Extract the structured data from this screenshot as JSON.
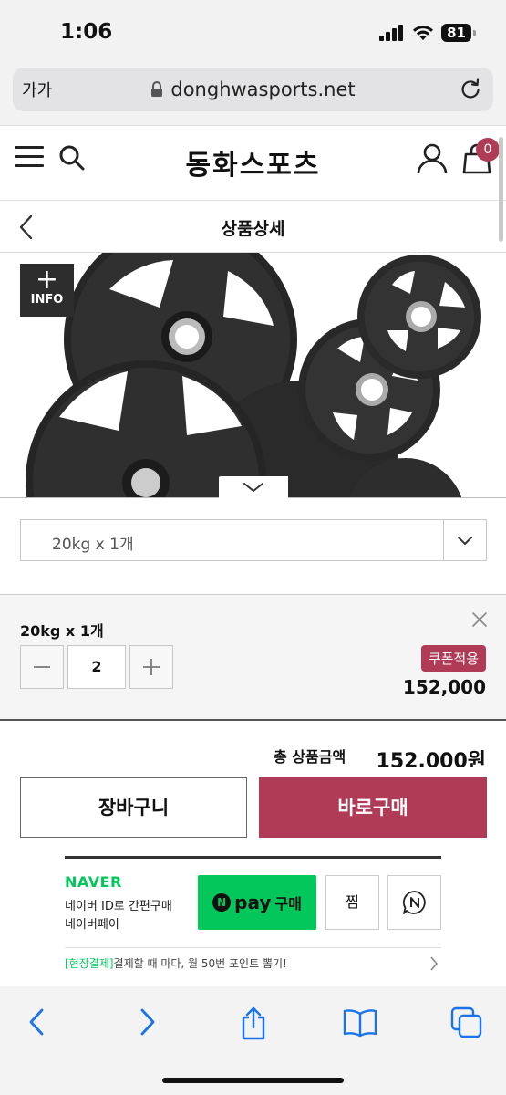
{
  "status_bar": {
    "time": "1:06",
    "battery": "81"
  },
  "browser": {
    "text_size_label": "가가",
    "url": "donghwasports.net"
  },
  "header": {
    "logo": "동화스포츠",
    "cart_count": "0"
  },
  "subheader": {
    "title": "상품상세"
  },
  "product": {
    "info_label": "INFO"
  },
  "option": {
    "selected_value": "20kg x 1개"
  },
  "selected_item": {
    "name": "20kg x 1개",
    "quantity": "2",
    "coupon_label": "쿠폰적용",
    "price": "152,000"
  },
  "total": {
    "label": "총 상품금액",
    "value": "152,000원"
  },
  "actions": {
    "cart_label": "장바구니",
    "buy_label": "바로구매"
  },
  "naver": {
    "logo": "NAVER",
    "line1": "네이버 ID로 간편구매",
    "line2": "네이버페이",
    "pay_n": "N",
    "pay_word": "pay",
    "pay_buy": "구매",
    "zzim_label": "찜",
    "notice_tag": "[현장결제]",
    "notice_text": "결제할 때 마다, 월 50번 포인트 뽑기!"
  },
  "colors": {
    "brand": "#b03b57",
    "naver_green": "#03c75a"
  }
}
